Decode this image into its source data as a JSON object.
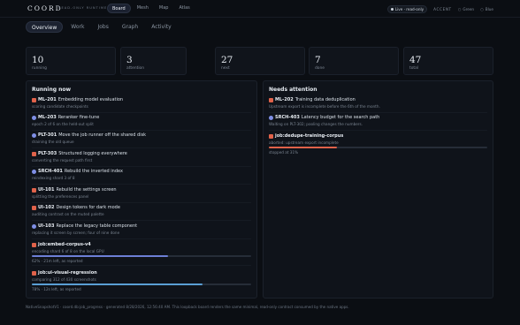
{
  "brand": {
    "name": "COORD",
    "subtitle": "READ-ONLY RUNTIME"
  },
  "nav": [
    "Board",
    "Mesh",
    "Map",
    "Atlas"
  ],
  "status": {
    "live": "Live · read-only",
    "accent_label": "ACCENT",
    "accent_options": [
      "Green",
      "Blue"
    ]
  },
  "tabs": [
    "Overview",
    "Work",
    "Jobs",
    "Graph",
    "Activity"
  ],
  "stats": [
    {
      "value": "10",
      "label": "running"
    },
    {
      "value": "3",
      "label": "attention"
    },
    {
      "value": "27",
      "label": "next"
    },
    {
      "value": "7",
      "label": "done"
    },
    {
      "value": "47",
      "label": "total"
    }
  ],
  "running": {
    "title": "Running now",
    "items": [
      {
        "icon": "bug-icon",
        "id": "ML-201",
        "title": "Embedding model evaluation",
        "sub": "scoring candidate checkpoints"
      },
      {
        "icon": "task-icon",
        "id": "ML-203",
        "title": "Reranker fine-tune",
        "sub": "epoch 2 of 6 on the held-out split"
      },
      {
        "icon": "task-icon",
        "id": "PLT-301",
        "title": "Move the job runner off the shared disk",
        "sub": "draining the old queue"
      },
      {
        "icon": "bug-icon",
        "id": "PLT-303",
        "title": "Structured logging everywhere",
        "sub": "converting the request path first"
      },
      {
        "icon": "task-icon",
        "id": "SRCH-401",
        "title": "Rebuild the inverted index",
        "sub": "reindexing shard 3 of 8"
      },
      {
        "icon": "bug-icon",
        "id": "UI-101",
        "title": "Rebuild the settings screen",
        "sub": "splitting the preferences panel"
      },
      {
        "icon": "bug-icon",
        "id": "UI-102",
        "title": "Design tokens for dark mode",
        "sub": "auditing contrast on the muted palette"
      },
      {
        "icon": "task-icon",
        "id": "UI-103",
        "title": "Replace the legacy table component",
        "sub": "replacing it screen by screen; four of nine done"
      }
    ],
    "jobs": [
      {
        "icon": "bug-icon",
        "id": "job:embed-corpus-v4",
        "sub": "encoding shard 6 of 8 on the local GPU",
        "progress": 0.62,
        "caption": "62% · 21m left, as reported",
        "color": "#6d7fd6"
      },
      {
        "icon": "bug-icon",
        "id": "job:ui-visual-regression",
        "sub": "comparing 312 of 430 screenshots",
        "progress": 0.78,
        "caption": "78% · 12s left, as reported",
        "color": "#5a9fd4"
      }
    ]
  },
  "attention": {
    "title": "Needs attention",
    "items": [
      {
        "icon": "bug-icon",
        "id": "ML-202",
        "title": "Training data deduplication",
        "sub": "Upstream export is incomplete before the 6th of the month."
      },
      {
        "icon": "task-icon",
        "id": "SRCH-403",
        "title": "Latency budget for the search path",
        "sub": "Waiting on PLT-302; pooling changes the numbers."
      }
    ],
    "job": {
      "icon": "bug-icon",
      "id": "job:dedupe-training-corpus",
      "sub": "aborted: upstream export incomplete",
      "progress": 0.31,
      "caption": "stopped at 31%",
      "color": "#e0624a"
    }
  },
  "footer": "NativeSnapshotV1 · coord.db:job_progress · generated 8/28/2026, 12:56:40 AM. This loopback board renders the same minimal, read-only contract consumed by the native apps."
}
